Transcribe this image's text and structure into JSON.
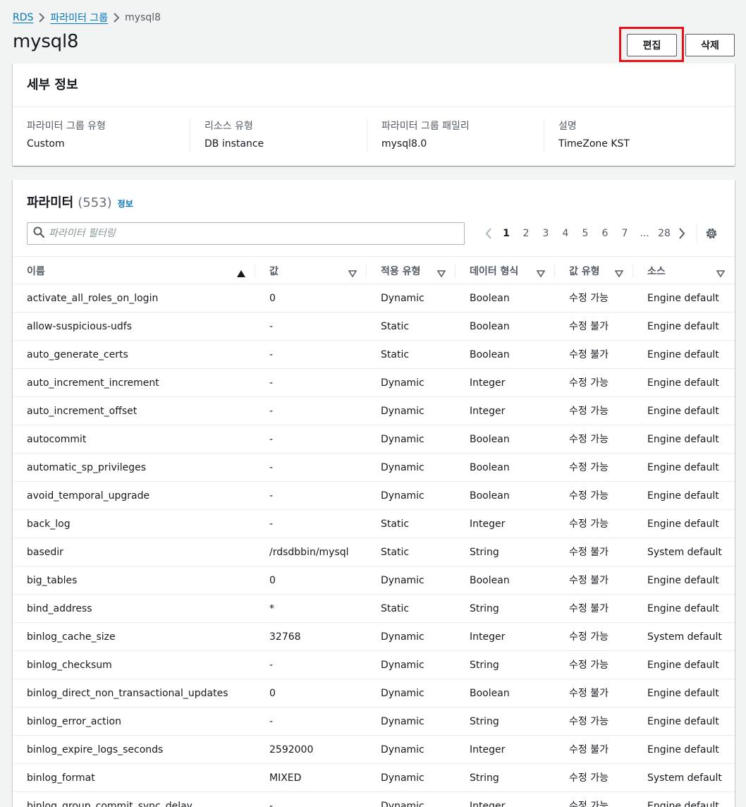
{
  "breadcrumb": {
    "items": [
      "RDS",
      "파라미터 그룹"
    ],
    "current": "mysql8"
  },
  "page": {
    "title": "mysql8",
    "edit_label": "편집",
    "delete_label": "삭제"
  },
  "details": {
    "title": "세부 정보",
    "fields": [
      {
        "label": "파라미터 그룹 유형",
        "value": "Custom"
      },
      {
        "label": "리소스 유형",
        "value": "DB instance"
      },
      {
        "label": "파라미터 그룹 패밀리",
        "value": "mysql8.0"
      },
      {
        "label": "설명",
        "value": "TimeZone KST"
      }
    ]
  },
  "params": {
    "title": "파라미터",
    "count": "(553)",
    "info_label": "정보",
    "filter_placeholder": "파라미터 필터링",
    "pagination": {
      "pages": [
        "1",
        "2",
        "3",
        "4",
        "5",
        "6",
        "7",
        "...",
        "28"
      ],
      "current": "1"
    },
    "columns": [
      "이름",
      "값",
      "적용 유형",
      "데이터 형식",
      "값 유형",
      "소스"
    ],
    "rows": [
      [
        "activate_all_roles_on_login",
        "0",
        "Dynamic",
        "Boolean",
        "수정 가능",
        "Engine default"
      ],
      [
        "allow-suspicious-udfs",
        "-",
        "Static",
        "Boolean",
        "수정 불가",
        "Engine default"
      ],
      [
        "auto_generate_certs",
        "-",
        "Static",
        "Boolean",
        "수정 불가",
        "Engine default"
      ],
      [
        "auto_increment_increment",
        "-",
        "Dynamic",
        "Integer",
        "수정 가능",
        "Engine default"
      ],
      [
        "auto_increment_offset",
        "-",
        "Dynamic",
        "Integer",
        "수정 가능",
        "Engine default"
      ],
      [
        "autocommit",
        "-",
        "Dynamic",
        "Boolean",
        "수정 가능",
        "Engine default"
      ],
      [
        "automatic_sp_privileges",
        "-",
        "Dynamic",
        "Boolean",
        "수정 가능",
        "Engine default"
      ],
      [
        "avoid_temporal_upgrade",
        "-",
        "Dynamic",
        "Boolean",
        "수정 가능",
        "Engine default"
      ],
      [
        "back_log",
        "-",
        "Static",
        "Integer",
        "수정 가능",
        "Engine default"
      ],
      [
        "basedir",
        "/rdsdbbin/mysql",
        "Static",
        "String",
        "수정 불가",
        "System default"
      ],
      [
        "big_tables",
        "0",
        "Dynamic",
        "Boolean",
        "수정 불가",
        "Engine default"
      ],
      [
        "bind_address",
        "*",
        "Static",
        "String",
        "수정 불가",
        "Engine default"
      ],
      [
        "binlog_cache_size",
        "32768",
        "Dynamic",
        "Integer",
        "수정 가능",
        "System default"
      ],
      [
        "binlog_checksum",
        "-",
        "Dynamic",
        "String",
        "수정 가능",
        "Engine default"
      ],
      [
        "binlog_direct_non_transactional_updates",
        "0",
        "Dynamic",
        "Boolean",
        "수정 불가",
        "Engine default"
      ],
      [
        "binlog_error_action",
        "-",
        "Dynamic",
        "String",
        "수정 가능",
        "Engine default"
      ],
      [
        "binlog_expire_logs_seconds",
        "2592000",
        "Dynamic",
        "Integer",
        "수정 불가",
        "Engine default"
      ],
      [
        "binlog_format",
        "MIXED",
        "Dynamic",
        "String",
        "수정 가능",
        "System default"
      ],
      [
        "binlog_group_commit_sync_delay",
        "-",
        "Dynamic",
        "Integer",
        "수정 가능",
        "Engine default"
      ]
    ]
  },
  "colors": {
    "link": "#0073bb",
    "highlight": "#e8111a",
    "background": "#f2f3f3"
  }
}
